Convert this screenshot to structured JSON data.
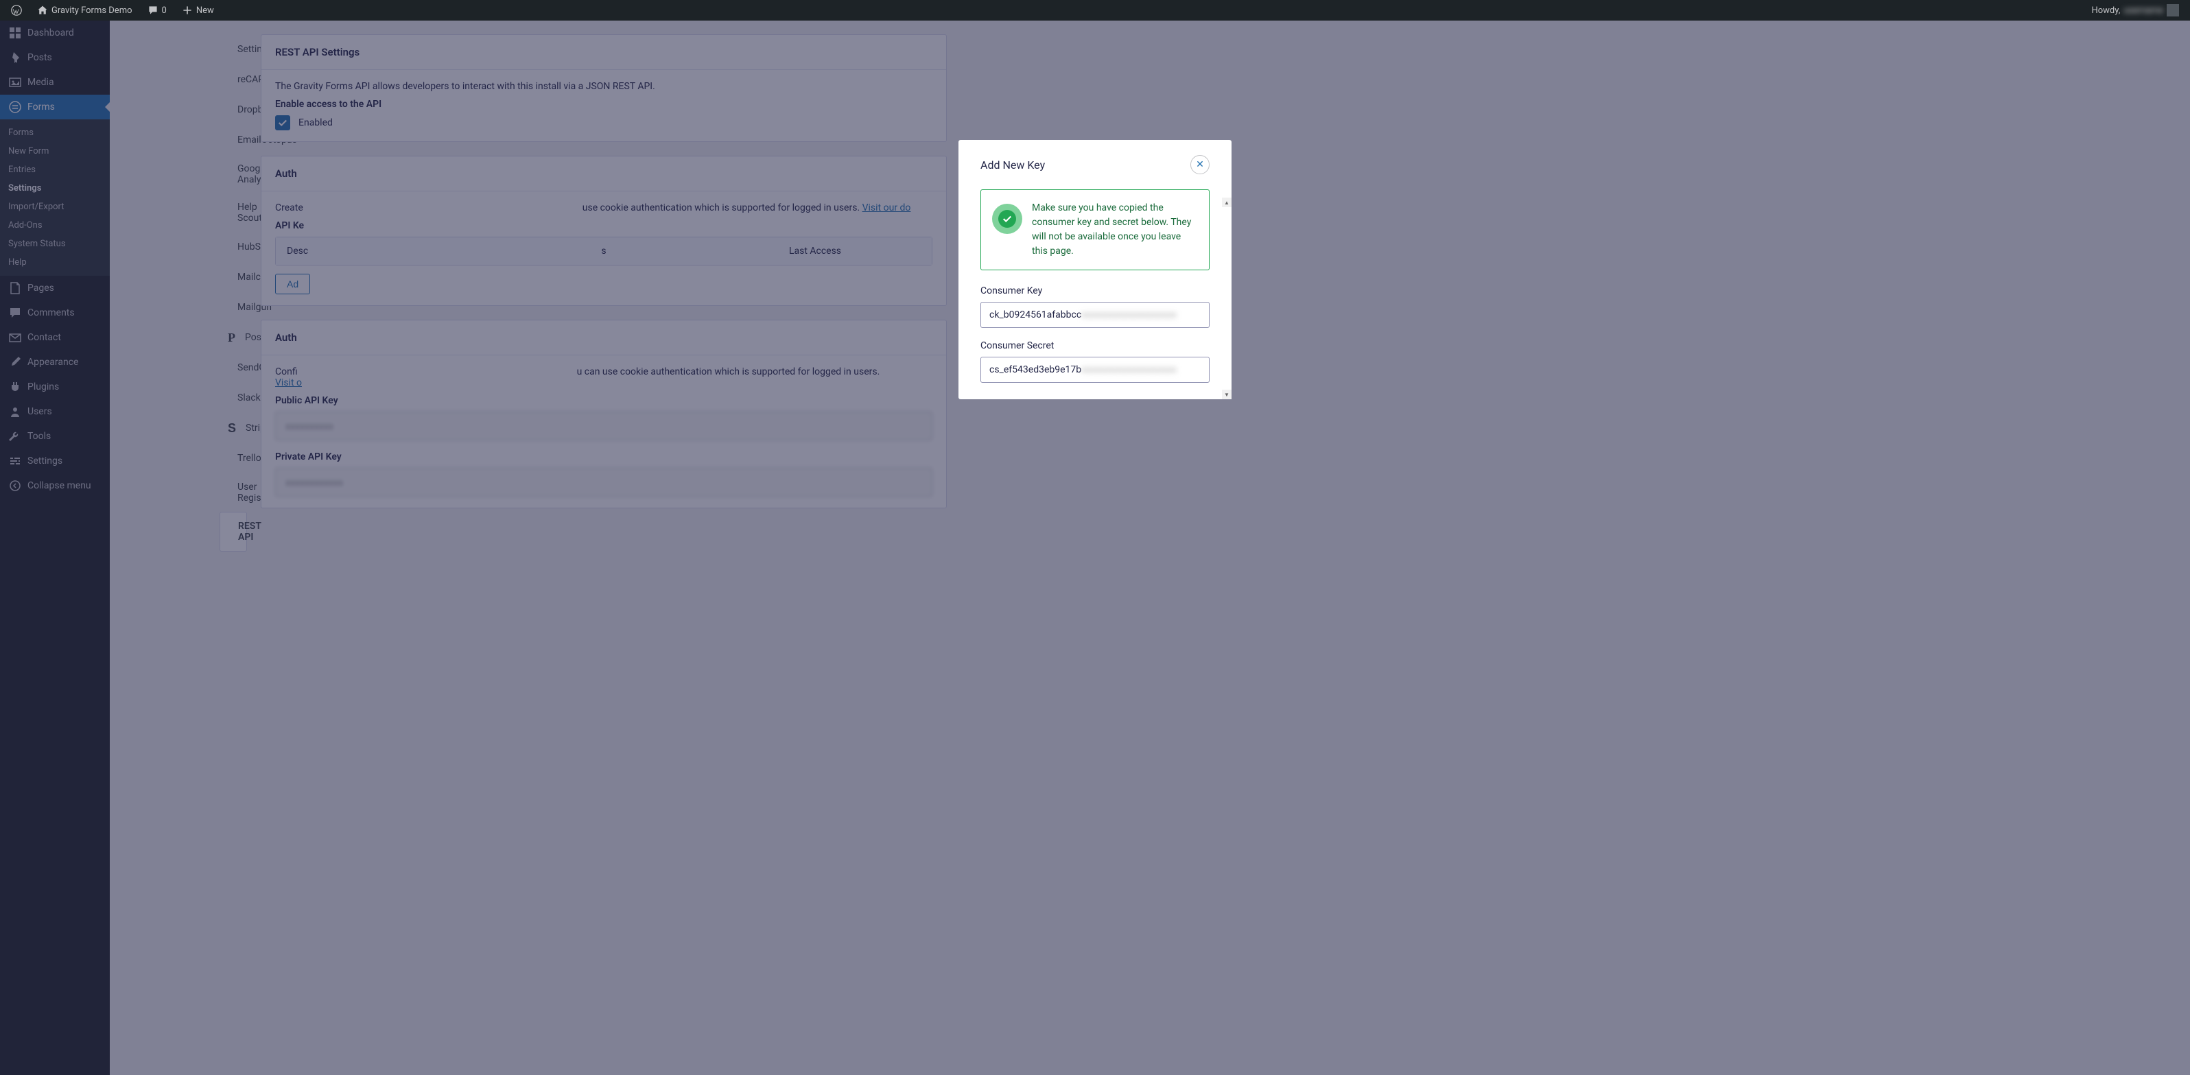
{
  "adminbar": {
    "site_name": "Gravity Forms Demo",
    "comments_count": "0",
    "new_label": "New",
    "howdy": "Howdy,",
    "username": "username"
  },
  "wp_sidebar": [
    {
      "label": "Dashboard",
      "icon": "dashboard"
    },
    {
      "label": "Posts",
      "icon": "pin"
    },
    {
      "label": "Media",
      "icon": "media"
    },
    {
      "label": "Forms",
      "icon": "forms",
      "current": true,
      "submenu": [
        {
          "label": "Forms"
        },
        {
          "label": "New Form"
        },
        {
          "label": "Entries"
        },
        {
          "label": "Settings",
          "current": true
        },
        {
          "label": "Import/Export"
        },
        {
          "label": "Add-Ons"
        },
        {
          "label": "System Status"
        },
        {
          "label": "Help"
        }
      ]
    },
    {
      "label": "Pages",
      "icon": "page"
    },
    {
      "label": "Comments",
      "icon": "comment"
    },
    {
      "label": "Contact",
      "icon": "mail"
    },
    {
      "label": "Appearance",
      "icon": "brush"
    },
    {
      "label": "Plugins",
      "icon": "plug"
    },
    {
      "label": "Users",
      "icon": "user"
    },
    {
      "label": "Tools",
      "icon": "wrench"
    },
    {
      "label": "Settings",
      "icon": "sliders"
    },
    {
      "label": "Collapse menu",
      "icon": "collapse"
    }
  ],
  "settings_nav": [
    {
      "label": "Settings",
      "icon": "gear"
    },
    {
      "label": "reCAPTCHA",
      "icon": "refresh"
    },
    {
      "label": "Dropbox",
      "icon": "dropbox"
    },
    {
      "label": "EmailOctopus",
      "icon": "octopus"
    },
    {
      "label": "Google Analytics",
      "icon": "bars"
    },
    {
      "label": "Help Scout",
      "icon": "scout"
    },
    {
      "label": "HubSpot",
      "icon": "hubspot"
    },
    {
      "label": "Mailchimp",
      "icon": "mailchimp"
    },
    {
      "label": "Mailgun",
      "icon": "mailgun"
    },
    {
      "label": "Postmark",
      "icon": "P"
    },
    {
      "label": "SendGrid",
      "icon": "grid"
    },
    {
      "label": "Slack",
      "icon": "slack"
    },
    {
      "label": "Stripe",
      "icon": "S"
    },
    {
      "label": "Trello",
      "icon": "trello"
    },
    {
      "label": "User Registration",
      "icon": "userreg"
    },
    {
      "label": "REST API",
      "icon": "api",
      "current": true
    }
  ],
  "rest_api": {
    "title": "REST API Settings",
    "description": "The Gravity Forms API allows developers to interact with this install via a JSON REST API.",
    "enable_label": "Enable access to the API",
    "enabled_text": "Enabled"
  },
  "auth_v2": {
    "title": "Auth",
    "body_pre": "Create",
    "body_post": "use cookie authentication which is supported for logged in users. ",
    "docs_link": "Visit our do",
    "api_keys_label": "API Ke",
    "table_cols": [
      "Desc",
      "s",
      "Last Access"
    ],
    "add_btn": "Ad"
  },
  "auth_v1": {
    "title": "Auth",
    "body_pre": "Confi",
    "body_post": "u can use cookie authentication which is supported for logged in users.",
    "docs_link": "Visit o",
    "public_label": "Public API Key",
    "public_value": "xxxxxxxxxx",
    "private_label": "Private API Key",
    "private_value": "xxxxxxxxxxxx"
  },
  "modal": {
    "title": "Add New Key",
    "notice": "Make sure you have copied the consumer key and secret below. They will not be available once you leave this page.",
    "consumer_key_label": "Consumer Key",
    "consumer_key_value": "ck_b0924561afabbcc",
    "consumer_key_blur": "xxxxxxxxxxxxxxxxxxxx",
    "consumer_secret_label": "Consumer Secret",
    "consumer_secret_value": "cs_ef543ed3eb9e17b",
    "consumer_secret_blur": "xxxxxxxxxxxxxxxxxxxx"
  }
}
